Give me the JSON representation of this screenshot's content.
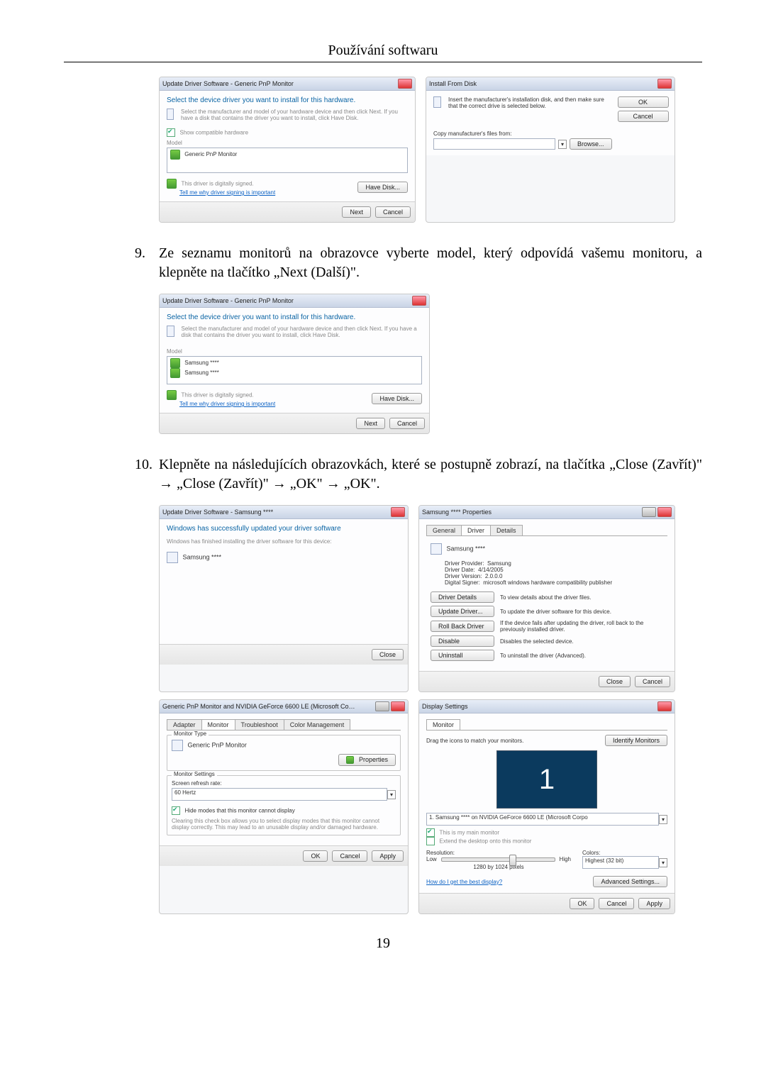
{
  "page": {
    "header": "Používání softwaru",
    "number": "19"
  },
  "steps": {
    "s9": {
      "num": "9.",
      "text": "Ze seznamu monitorů na obrazovce vyberte model, který odpovídá vašemu monitoru, a klepněte na tlačítko „Next (Další)\"."
    },
    "s10": {
      "num": "10.",
      "text": "Klepněte na následujících obrazovkách, které se postupně zobrazí, na tlačítka „Close (Zavřít)\" → „Close (Zavřít)\" → „OK\" → „OK\"."
    }
  },
  "dlg": {
    "upd1": {
      "title": "Update Driver Software - Generic PnP Monitor",
      "heading": "Select the device driver you want to install for this hardware.",
      "desc": "Select the manufacturer and model of your hardware device and then click Next. If you have a disk that contains the driver you want to install, click Have Disk.",
      "show_compat": "Show compatible hardware",
      "model_label": "Model",
      "model_item": "Generic PnP Monitor",
      "signed": "This driver is digitally signed.",
      "signed_link": "Tell me why driver signing is important",
      "have_disk": "Have Disk...",
      "next": "Next",
      "cancel": "Cancel"
    },
    "ifd": {
      "title": "Install From Disk",
      "msg": "Insert the manufacturer's installation disk, and then make sure that the correct drive is selected below.",
      "copy_label": "Copy manufacturer's files from:",
      "browse": "Browse...",
      "ok": "OK",
      "cancel": "Cancel"
    },
    "upd2": {
      "title": "Update Driver Software - Generic PnP Monitor",
      "heading": "Select the device driver you want to install for this hardware.",
      "desc": "Select the manufacturer and model of your hardware device and then click Next. If you have a disk that contains the driver you want to install, click Have Disk.",
      "model_label": "Model",
      "model_item1": "Samsung ****",
      "model_item2": "Samsung ****",
      "signed": "This driver is digitally signed.",
      "signed_link": "Tell me why driver signing is important",
      "have_disk": "Have Disk...",
      "next": "Next",
      "cancel": "Cancel"
    },
    "upd3": {
      "title": "Update Driver Software - Samsung ****",
      "heading": "Windows has successfully updated your driver software",
      "desc": "Windows has finished installing the driver software for this device:",
      "item": "Samsung ****",
      "close": "Close"
    },
    "props": {
      "title": "Samsung **** Properties",
      "tab_general": "General",
      "tab_driver": "Driver",
      "tab_details": "Details",
      "device": "Samsung ****",
      "row1l": "Driver Provider:",
      "row1v": "Samsung",
      "row2l": "Driver Date:",
      "row2v": "4/14/2005",
      "row3l": "Driver Version:",
      "row3v": "2.0.0.0",
      "row4l": "Digital Signer:",
      "row4v": "microsoft windows hardware compatibility publisher",
      "btn_details": "Driver Details",
      "btn_details_txt": "To view details about the driver files.",
      "btn_update": "Update Driver...",
      "btn_update_txt": "To update the driver software for this device.",
      "btn_rollback": "Roll Back Driver",
      "btn_rollback_txt": "If the device fails after updating the driver, roll back to the previously installed driver.",
      "btn_disable": "Disable",
      "btn_disable_txt": "Disables the selected device.",
      "btn_uninstall": "Uninstall",
      "btn_uninstall_txt": "To uninstall the driver (Advanced).",
      "close": "Close",
      "cancel": "Cancel"
    },
    "genprops": {
      "title": "Generic PnP Monitor and NVIDIA GeForce 6600 LE (Microsoft Co…",
      "tab_adapter": "Adapter",
      "tab_monitor": "Monitor",
      "tab_trouble": "Troubleshoot",
      "tab_color": "Color Management",
      "g1_title": "Monitor Type",
      "g1_item": "Generic PnP Monitor",
      "g1_btn": "Properties",
      "g2_title": "Monitor Settings",
      "g2_refresh": "Screen refresh rate:",
      "g2_hz": "60 Hertz",
      "g2_chk": "Hide modes that this monitor cannot display",
      "g2_note": "Clearing this check box allows you to select display modes that this monitor cannot display correctly. This may lead to an unusable display and/or damaged hardware.",
      "ok": "OK",
      "cancel": "Cancel",
      "apply": "Apply"
    },
    "disp": {
      "title": "Display Settings",
      "tab": "Monitor",
      "drag": "Drag the icons to match your monitors.",
      "identify": "Identify Monitors",
      "sel": "1. Samsung **** on NVIDIA GeForce 6600 LE (Microsoft Corpo",
      "chk_main": "This is my main monitor",
      "chk_extend": "Extend the desktop onto this monitor",
      "res_label": "Resolution:",
      "res_low": "Low",
      "res_high": "High",
      "res_value": "1280 by 1024 pixels",
      "col_label": "Colors:",
      "col_value": "Highest (32 bit)",
      "best_link": "How do I get the best display?",
      "adv": "Advanced Settings...",
      "ok": "OK",
      "cancel": "Cancel",
      "apply": "Apply"
    }
  }
}
